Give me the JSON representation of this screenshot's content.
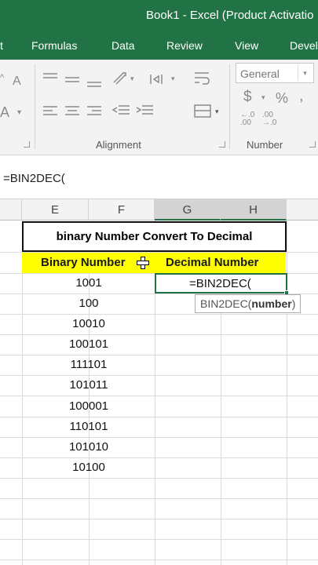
{
  "titlebar": {
    "title": "Book1 - Excel (Product Activatio"
  },
  "menu": {
    "tab_insert_fragment": "t",
    "formulas": "Formulas",
    "data": "Data",
    "review": "Review",
    "view": "View",
    "developer_fragment": "Devel"
  },
  "ribbon": {
    "alignment_label": "Alignment",
    "number_label": "Number",
    "number_format": "General",
    "currency_symbol": "$",
    "percent_symbol": "%",
    "comma_symbol": ",",
    "font_size_up": "A",
    "font_a": "A",
    "decrease_decimals": "·.0\n.00",
    "increase_decimals": ".00\n→.0"
  },
  "formula_bar": {
    "text": "=BIN2DEC("
  },
  "columns": [
    "E",
    "F",
    "G",
    "H"
  ],
  "sheet": {
    "heading": "binary Number Convert To Decimal",
    "col_header_binary": "Binary Number",
    "col_header_decimal": "Decimal Number",
    "binary_values": [
      "1001",
      "100",
      "10010",
      "100101",
      "111101",
      "101011",
      "100001",
      "110101",
      "101010",
      "10100"
    ],
    "active_cell_text": "=BIN2DEC(",
    "tooltip_fn": "BIN2DEC(",
    "tooltip_arg": "number",
    "tooltip_close": ")"
  },
  "colors": {
    "excel_green": "#217346",
    "header_fill": "#ffff00"
  }
}
